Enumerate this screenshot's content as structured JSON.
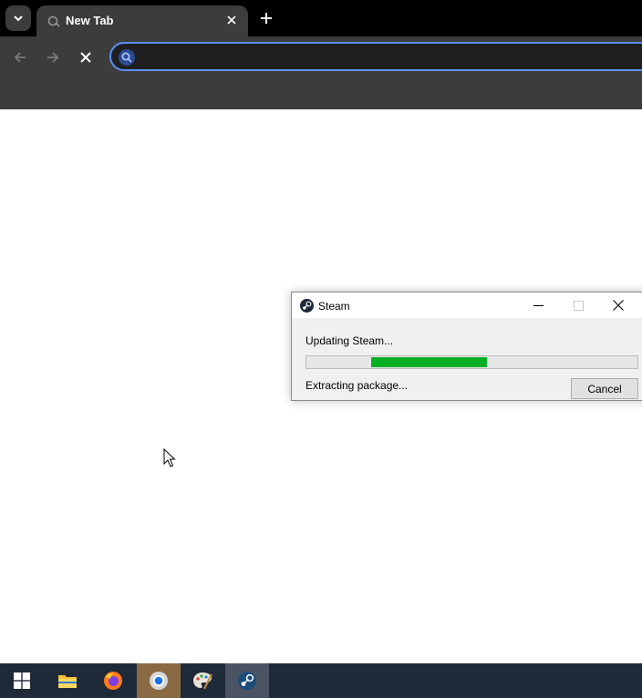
{
  "browser": {
    "tab": {
      "title": "New Tab"
    },
    "omnibox": {
      "value": "",
      "placeholder": ""
    }
  },
  "dialog": {
    "title": "Steam",
    "status": "Updating Steam...",
    "progress": {
      "start_fraction": 0.195,
      "end_fraction": 0.545
    },
    "detail": "Extracting package...",
    "cancel_label": "Cancel"
  },
  "colors": {
    "progress_fill": "#06b025",
    "omnibox_border": "#5b8ff9",
    "taskbar": "#1f2a38"
  },
  "taskbar": {
    "items": [
      {
        "name": "start",
        "icon": "windows-icon"
      },
      {
        "name": "file-explorer",
        "icon": "folder-icon"
      },
      {
        "name": "firefox",
        "icon": "firefox-icon"
      },
      {
        "name": "chrome",
        "icon": "chrome-icon"
      },
      {
        "name": "paint",
        "icon": "palette-icon"
      },
      {
        "name": "steam",
        "icon": "steam-icon"
      }
    ]
  }
}
